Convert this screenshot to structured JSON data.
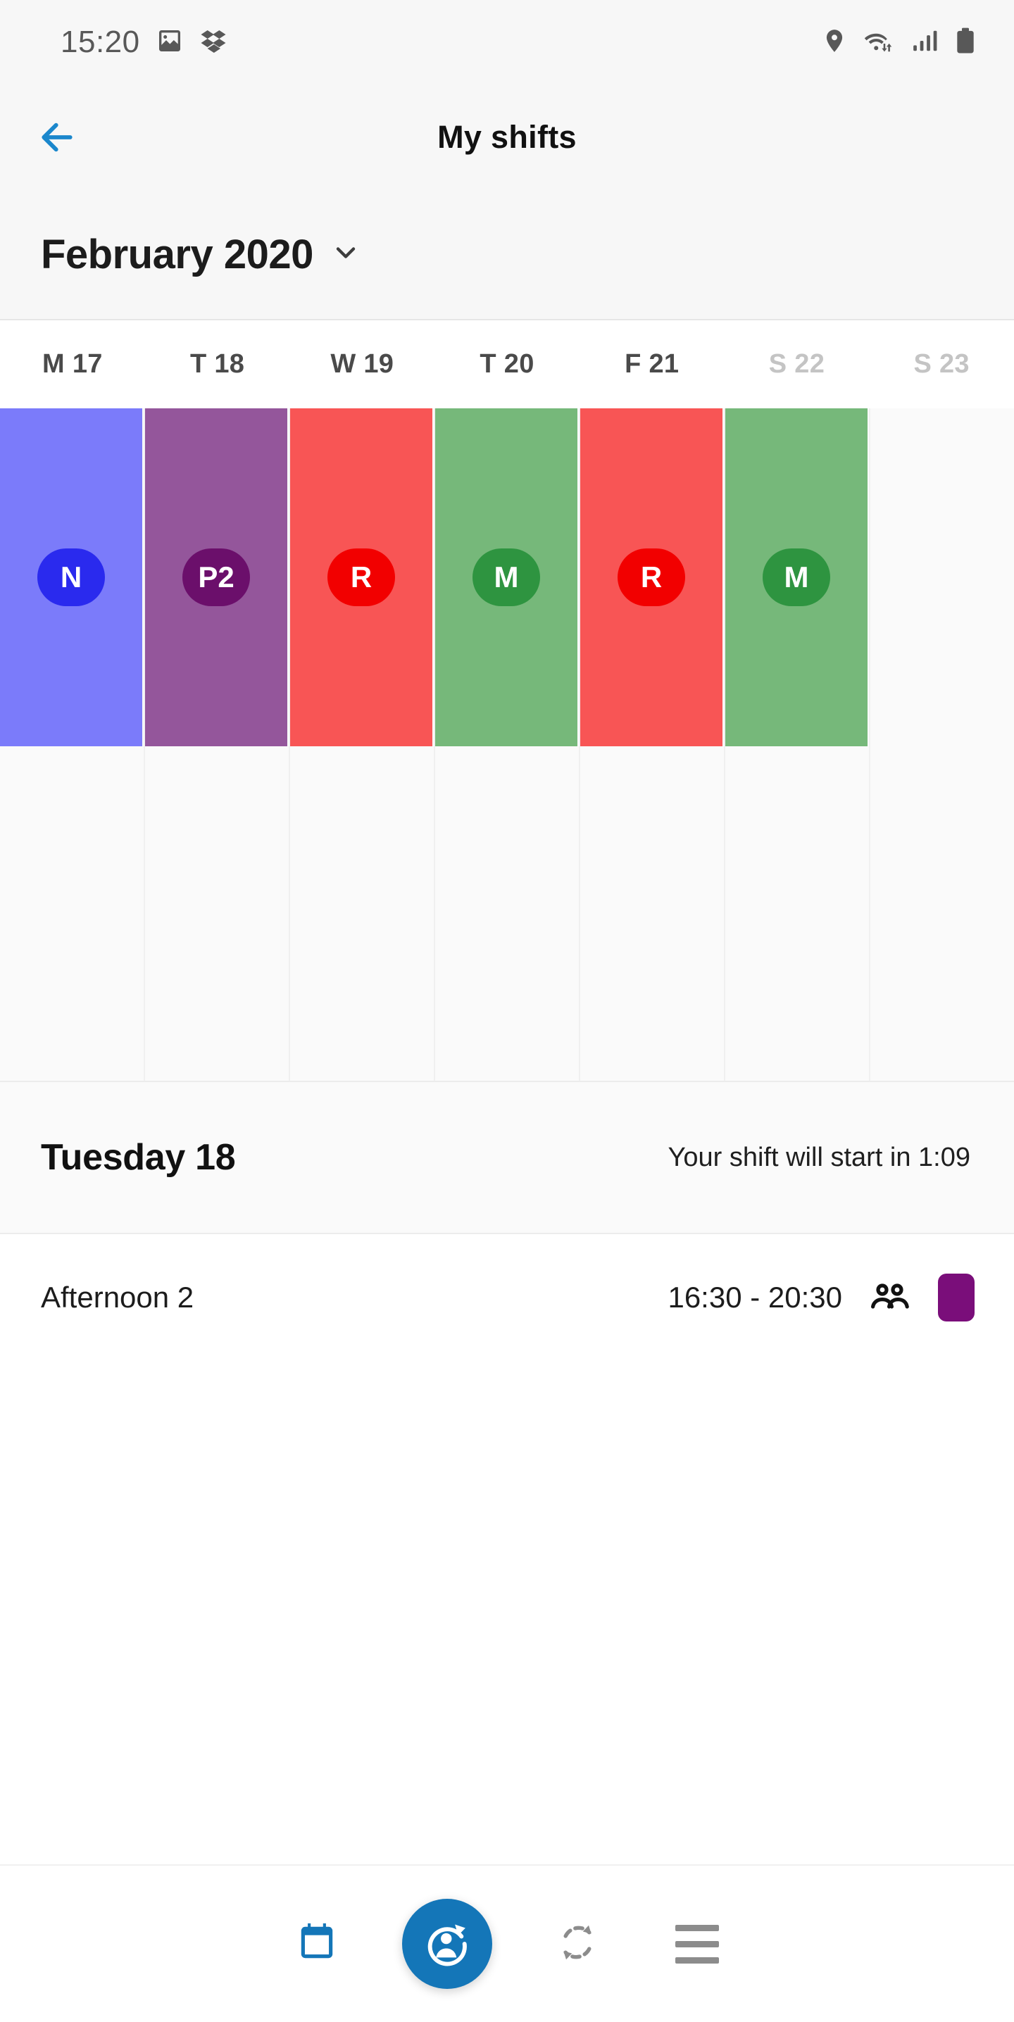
{
  "statusbar": {
    "time": "15:20",
    "left_icons": [
      "photos-icon",
      "dropbox-icon"
    ],
    "right_icons": [
      "location-pin-icon",
      "wifi-icon",
      "signal-bars-icon",
      "battery-icon"
    ]
  },
  "appbar": {
    "back_label": "back-arrow",
    "title": "My shifts"
  },
  "month_selector": {
    "label": "February 2020",
    "chevron": "chevron-down-icon"
  },
  "calendar": {
    "days": [
      {
        "label": "M 17",
        "weekend": false
      },
      {
        "label": "T 18",
        "weekend": false
      },
      {
        "label": "W 19",
        "weekend": false
      },
      {
        "label": "T 20",
        "weekend": false
      },
      {
        "label": "F 21",
        "weekend": false
      },
      {
        "label": "S 22",
        "weekend": true
      },
      {
        "label": "S 23",
        "weekend": true
      }
    ],
    "shifts": [
      {
        "code": "N",
        "block_color": "#7b7bfa",
        "badge_color": "#2a2aee"
      },
      {
        "code": "P2",
        "block_color": "#94569b",
        "badge_color": "#6b0f6b"
      },
      {
        "code": "R",
        "block_color": "#f85555",
        "badge_color": "#f20000"
      },
      {
        "code": "M",
        "block_color": "#76b87a",
        "badge_color": "#2e9440"
      },
      {
        "code": "R",
        "block_color": "#f85555",
        "badge_color": "#f20000"
      },
      {
        "code": "M",
        "block_color": "#76b87a",
        "badge_color": "#2e9440"
      },
      {
        "code": "",
        "block_color": "",
        "badge_color": ""
      }
    ]
  },
  "day_detail": {
    "title": "Tuesday 18",
    "note": "Your shift will start in 1:09"
  },
  "shift_row": {
    "name": "Afternoon 2",
    "time": "16:30 - 20:30",
    "people_icon": "people-icon",
    "chip_color": "#7a0e7a"
  },
  "bottom_nav": {
    "items": [
      {
        "icon": "calendar-icon",
        "active": true
      },
      {
        "icon": "shift-swap-fab-icon",
        "active": true
      },
      {
        "icon": "exchange-arrows-icon",
        "active": false
      },
      {
        "icon": "menu-icon",
        "active": false
      }
    ]
  },
  "colors": {
    "accent_blue": "#1476b8",
    "back_arrow_blue": "#1b87cc",
    "header_bg": "#f7f7f7",
    "grid_bg": "#fafafa"
  }
}
